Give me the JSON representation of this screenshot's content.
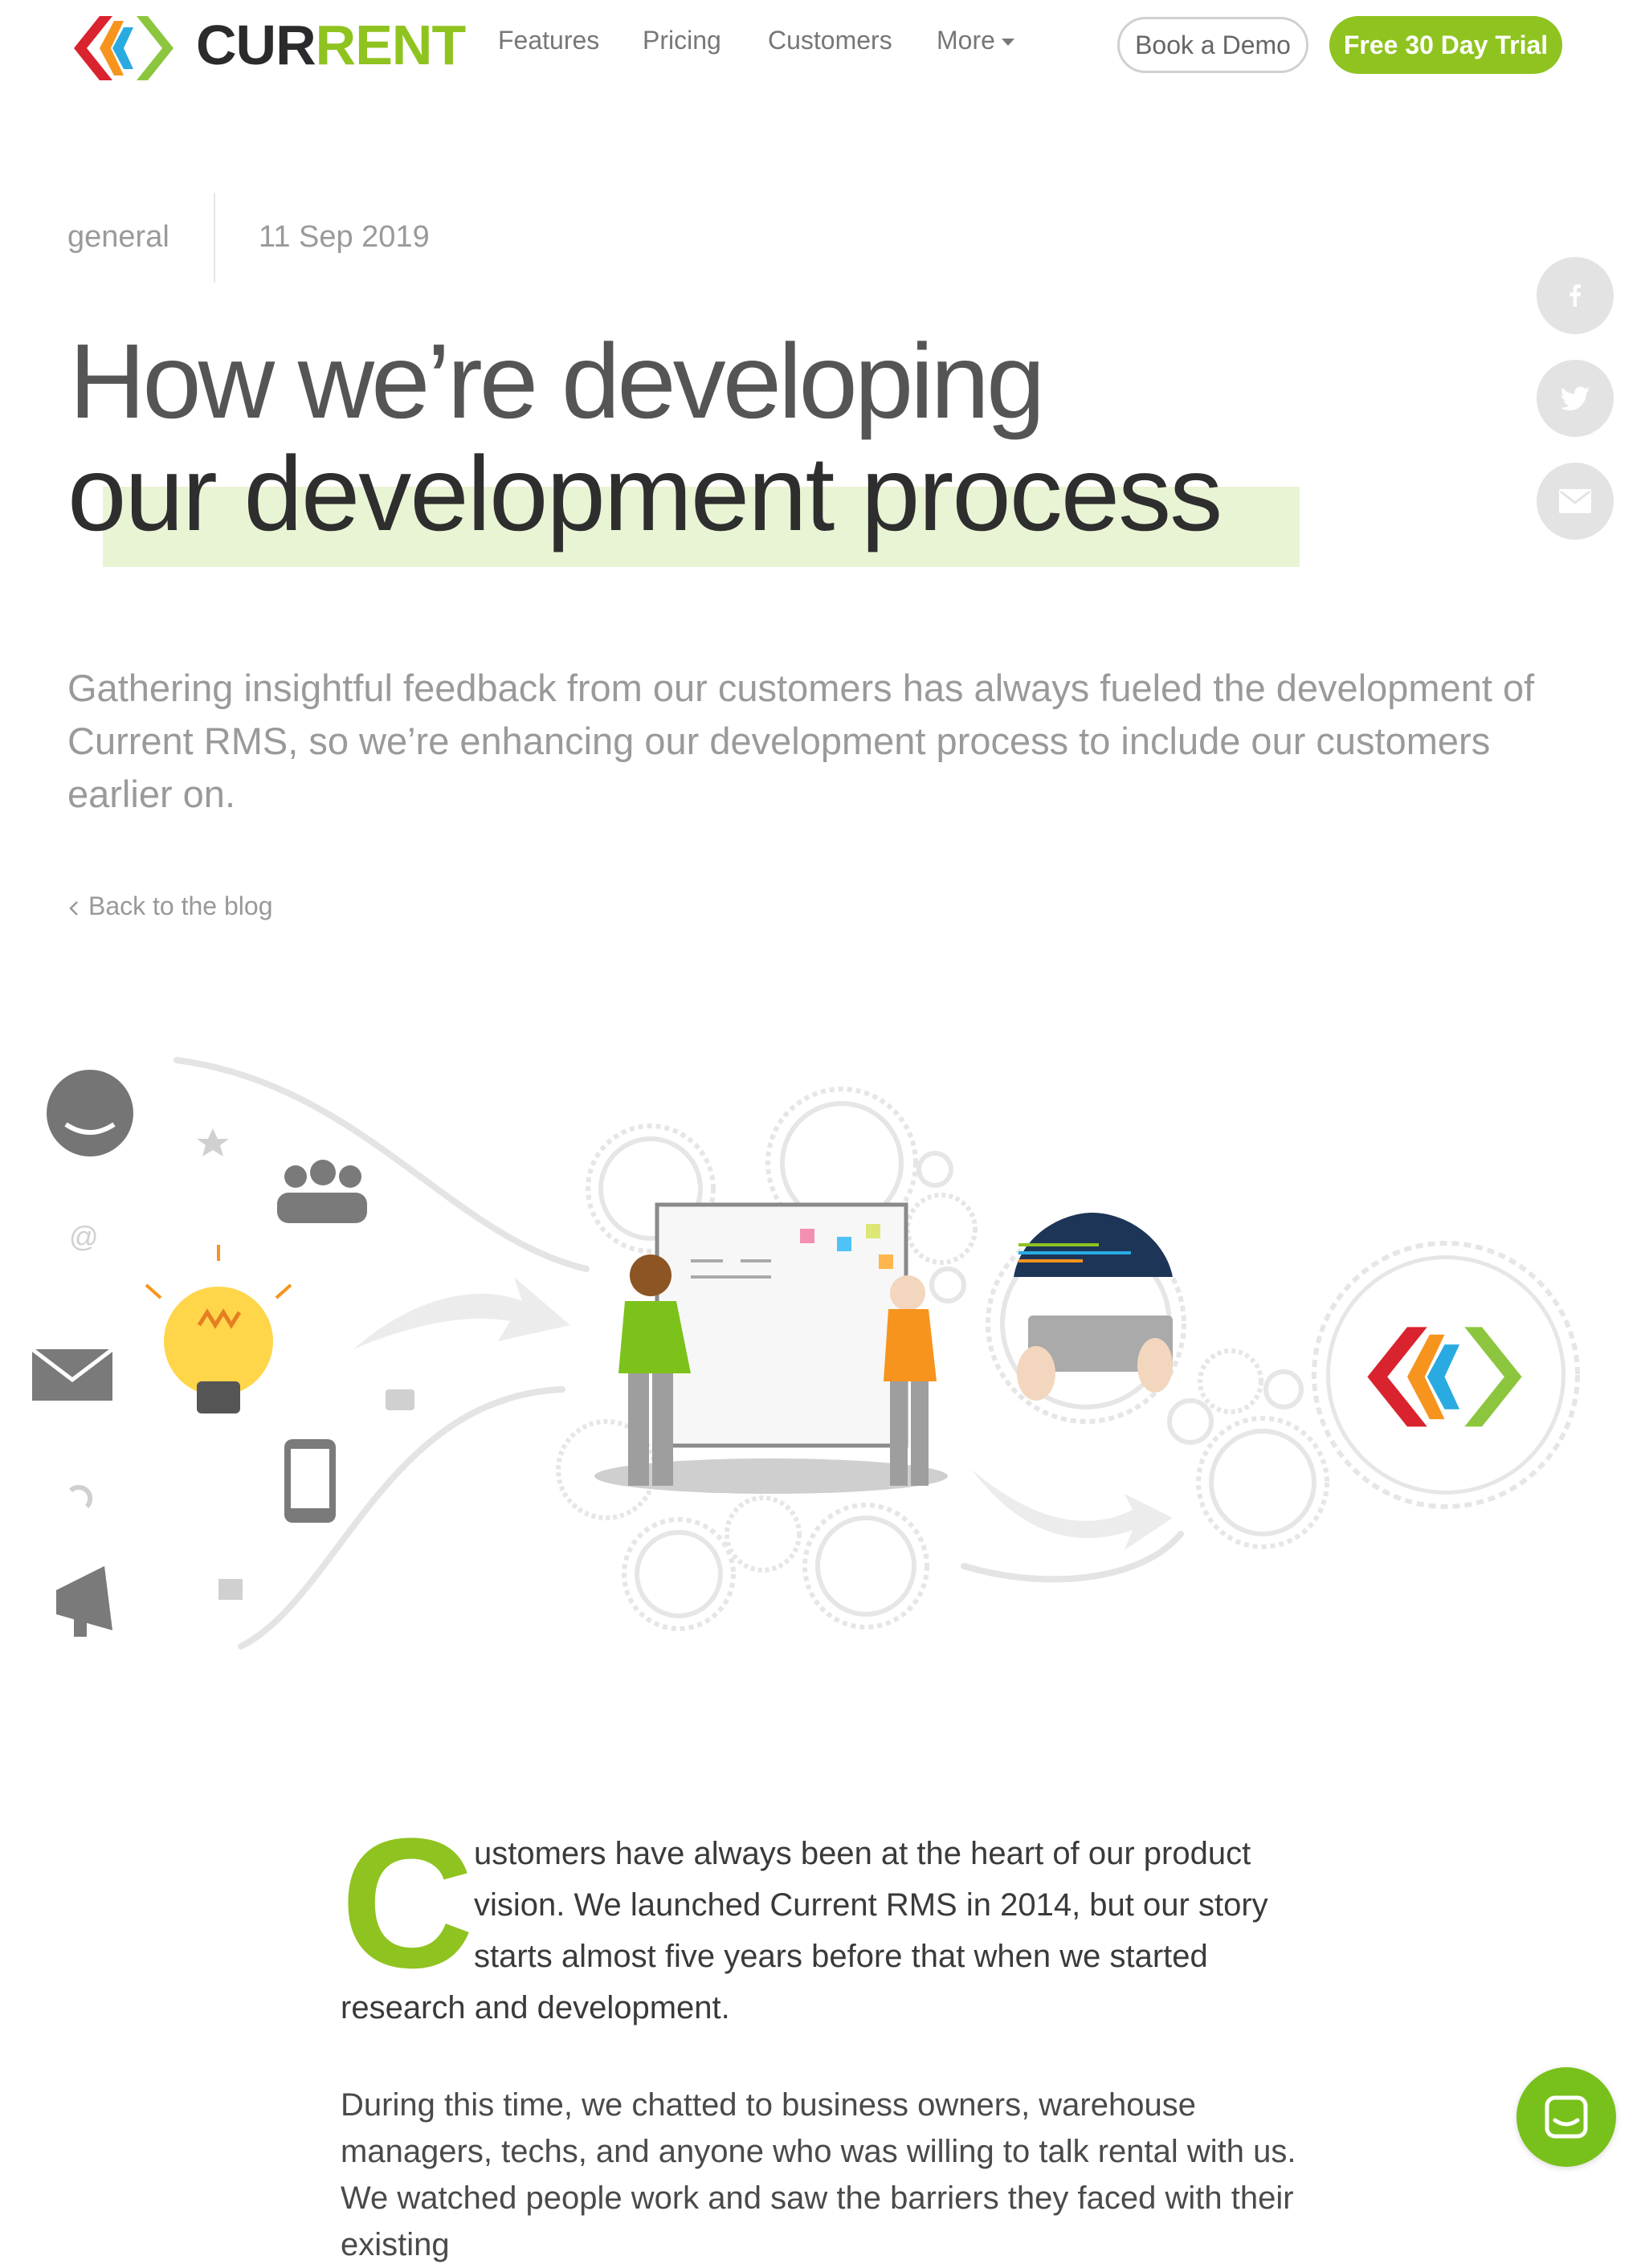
{
  "brand": {
    "wordmark_prefix": "CUR",
    "wordmark_suffix": "RENT",
    "accent_color": "#8fc320",
    "logo_colors": [
      "#d9232e",
      "#f7941d",
      "#29abe2",
      "#8cc63f"
    ]
  },
  "nav": {
    "items": [
      {
        "label": "Features"
      },
      {
        "label": "Pricing"
      },
      {
        "label": "Customers"
      },
      {
        "label": "More"
      }
    ],
    "demo_label": "Book a Demo",
    "trial_label": "Free 30 Day Trial"
  },
  "post": {
    "category": "general",
    "date": "11 Sep 2019",
    "title_line1": "How we’re developing",
    "title_line2": "our development process",
    "intro": "Gathering insightful feedback from our customers has always fueled the development of Current RMS, so we’re enhancing our development process to include our customers earlier on.",
    "back_label": "Back to the blog",
    "body_p1_dropcap": "C",
    "body_p1_rest": "ustomers have always been at the heart of our product vision. We launched Current RMS in 2014, but our story starts almost five years before that when we started research and development.",
    "body_p2": "During this time, we chatted to business owners, warehouse managers, techs, and anyone who was willing to talk rental with us. We watched people work and saw the barriers they faced with their existing"
  },
  "share": {
    "icons": [
      "facebook-icon",
      "twitter-icon",
      "email-icon"
    ]
  },
  "chat": {
    "icon": "chat-icon",
    "color": "#78c11c"
  }
}
